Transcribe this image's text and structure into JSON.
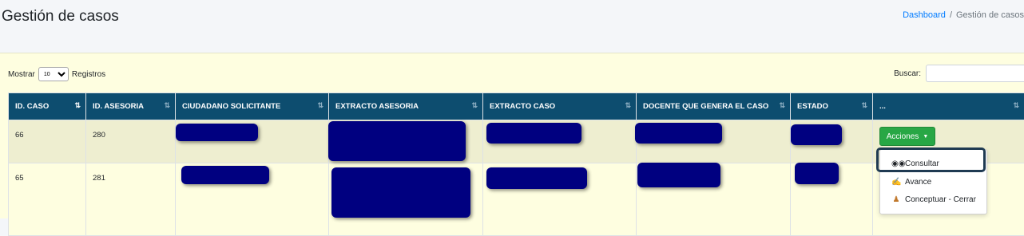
{
  "header": {
    "title": "Gestión de casos",
    "breadcrumb": {
      "link": "Dashboard",
      "separator": "/",
      "current": "Gestión de casos"
    }
  },
  "table_controls": {
    "length_prefix": "Mostrar",
    "length_value": "10",
    "length_suffix": "Registros",
    "search_label": "Buscar:",
    "search_value": ""
  },
  "table": {
    "columns": [
      {
        "label": "ID. CASO",
        "sort": "active"
      },
      {
        "label": "ID. ASESORIA",
        "sort": "both"
      },
      {
        "label": "CIUDADANO SOLICITANTE",
        "sort": "both"
      },
      {
        "label": "EXTRACTO ASESORIA",
        "sort": "both"
      },
      {
        "label": "EXTRACTO CASO",
        "sort": "both"
      },
      {
        "label": "DOCENTE QUE GENERA EL CASO",
        "sort": "both"
      },
      {
        "label": "ESTADO",
        "sort": "both"
      },
      {
        "label": "...",
        "sort": "both"
      }
    ],
    "rows": [
      {
        "id_caso": "66",
        "id_asesoria": "280"
      },
      {
        "id_caso": "65",
        "id_asesoria": "281"
      }
    ]
  },
  "actions": {
    "button_label": "Acciones",
    "menu": [
      {
        "label": "Consultar",
        "icon": "binoculars-icon"
      },
      {
        "label": "Avance",
        "icon": "pencil-hand-icon"
      },
      {
        "label": "Conceptuar - Cerrar",
        "icon": "user-gavel-icon"
      }
    ]
  },
  "colors": {
    "table_header": "#0d4d6f",
    "redaction": "#000080",
    "action_button": "#28a745",
    "card_background": "#fefee0"
  }
}
